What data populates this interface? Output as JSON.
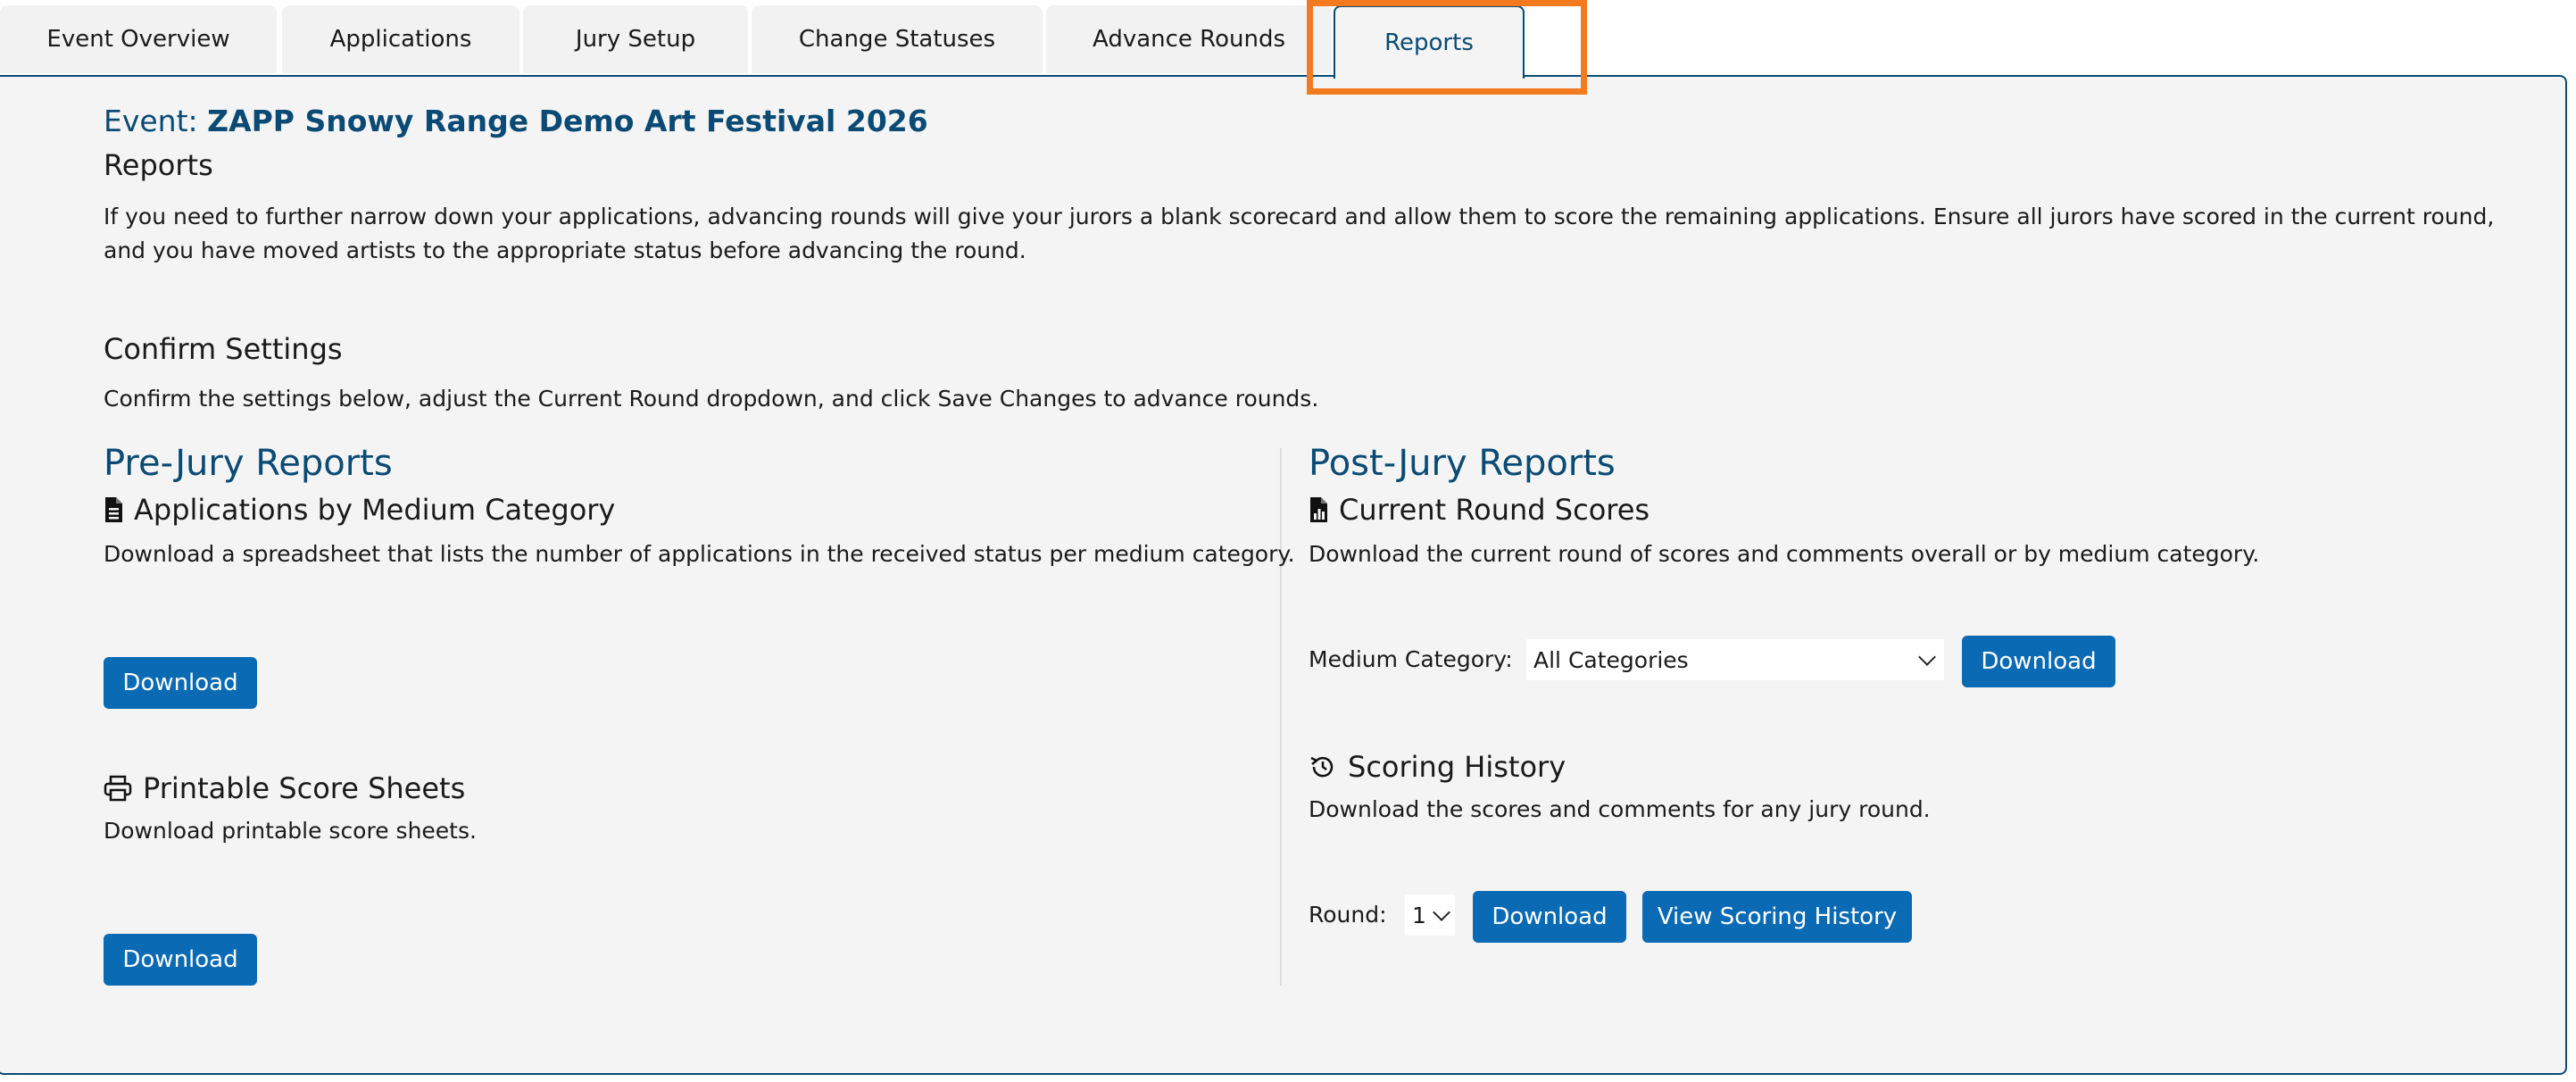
{
  "tabs": [
    {
      "label": "Event Overview"
    },
    {
      "label": "Applications"
    },
    {
      "label": "Jury Setup"
    },
    {
      "label": "Change Statuses"
    },
    {
      "label": "Advance Rounds"
    },
    {
      "label": "Reports"
    }
  ],
  "active_tab": "Reports",
  "event": {
    "prefix": "Event:",
    "name": "ZAPP Snowy Range Demo Art Festival 2026"
  },
  "page": {
    "heading": "Reports",
    "intro": "If you need to further narrow down your applications, advancing rounds will give your jurors a blank scorecard and allow them to score the remaining applications. Ensure all jurors have scored in the current round, and you have moved artists to the appropriate status before advancing the round.",
    "confirm_heading": "Confirm Settings",
    "confirm_text": "Confirm the settings below, adjust the Current Round dropdown, and click Save Changes to advance rounds."
  },
  "pre_jury": {
    "title": "Pre-Jury Reports",
    "by_medium": {
      "heading": "Applications by Medium Category",
      "icon": "file-text-icon",
      "desc": "Download a spreadsheet that lists the number of applications in the received status per medium category.",
      "button": "Download"
    },
    "score_sheets": {
      "heading": "Printable Score Sheets",
      "icon": "printer-icon",
      "desc": "Download printable score sheets.",
      "button": "Download"
    }
  },
  "post_jury": {
    "title": "Post-Jury Reports",
    "current_round": {
      "heading": "Current Round Scores",
      "icon": "file-chart-icon",
      "desc": "Download the current round of scores and comments overall or by medium category.",
      "medium_label": "Medium Category:",
      "medium_value": "All Categories",
      "button": "Download"
    },
    "history": {
      "heading": "Scoring History",
      "icon": "history-icon",
      "desc": "Download the scores and comments for any jury round.",
      "round_label": "Round:",
      "round_value": "1",
      "button": "Download",
      "view_button": "View Scoring History"
    }
  },
  "colors": {
    "accent": "#0a4a74",
    "button": "#0a6ab4",
    "highlight": "#f47a20",
    "panel": "#f4f4f4"
  }
}
